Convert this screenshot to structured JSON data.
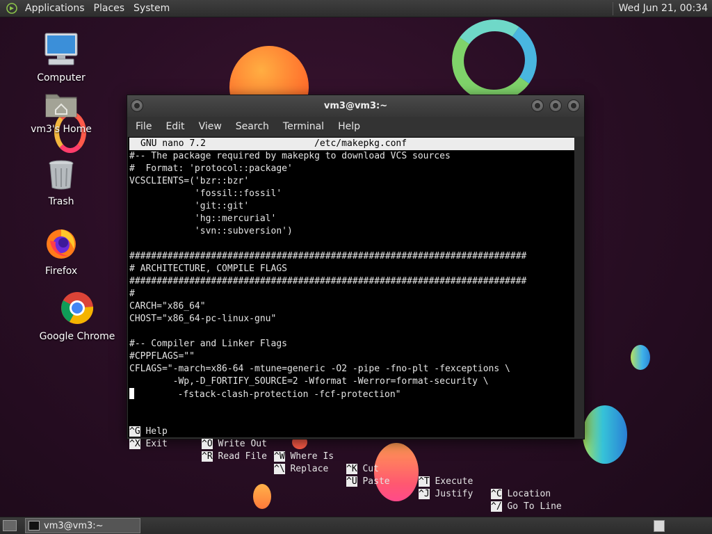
{
  "top_panel": {
    "menus": [
      "Applications",
      "Places",
      "System"
    ],
    "clock": "Wed Jun 21, 00:34"
  },
  "desktop_icons": [
    {
      "label": "Computer",
      "icon": "computer-icon"
    },
    {
      "label": "vm3's Home",
      "icon": "home-folder-icon"
    },
    {
      "label": "Trash",
      "icon": "trash-icon"
    },
    {
      "label": "Firefox",
      "icon": "firefox-icon"
    },
    {
      "label": "Google Chrome",
      "icon": "chrome-icon"
    }
  ],
  "window": {
    "title": "vm3@vm3:~",
    "menu": [
      "File",
      "Edit",
      "View",
      "Search",
      "Terminal",
      "Help"
    ]
  },
  "nano": {
    "version": "GNU nano 7.2",
    "filename": "/etc/makepkg.conf",
    "lines": [
      "#-- The package required by makepkg to download VCS sources",
      "#  Format: 'protocol::package'",
      "VCSCLIENTS=('bzr::bzr'",
      "            'fossil::fossil'",
      "            'git::git'",
      "            'hg::mercurial'",
      "            'svn::subversion')",
      "",
      "#########################################################################",
      "# ARCHITECTURE, COMPILE FLAGS",
      "#########################################################################",
      "#",
      "CARCH=\"x86_64\"",
      "CHOST=\"x86_64-pc-linux-gnu\"",
      "",
      "#-- Compiler and Linker Flags",
      "#CPPFLAGS=\"\"",
      "CFLAGS=\"-march=x86-64 -mtune=generic -O2 -pipe -fno-plt -fexceptions \\",
      "        -Wp,-D_FORTIFY_SOURCE=2 -Wformat -Werror=format-security \\",
      "        -fstack-clash-protection -fcf-protection\""
    ],
    "shortcuts_row1": [
      {
        "key": "^G",
        "label": "Help"
      },
      {
        "key": "^O",
        "label": "Write Out"
      },
      {
        "key": "^W",
        "label": "Where Is"
      },
      {
        "key": "^K",
        "label": "Cut"
      },
      {
        "key": "^T",
        "label": "Execute"
      },
      {
        "key": "^C",
        "label": "Location"
      }
    ],
    "shortcuts_row2": [
      {
        "key": "^X",
        "label": "Exit"
      },
      {
        "key": "^R",
        "label": "Read File"
      },
      {
        "key": "^\\",
        "label": "Replace"
      },
      {
        "key": "^U",
        "label": "Paste"
      },
      {
        "key": "^J",
        "label": "Justify"
      },
      {
        "key": "^/",
        "label": "Go To Line"
      }
    ]
  },
  "bottom_panel": {
    "task_label": "vm3@vm3:~"
  }
}
